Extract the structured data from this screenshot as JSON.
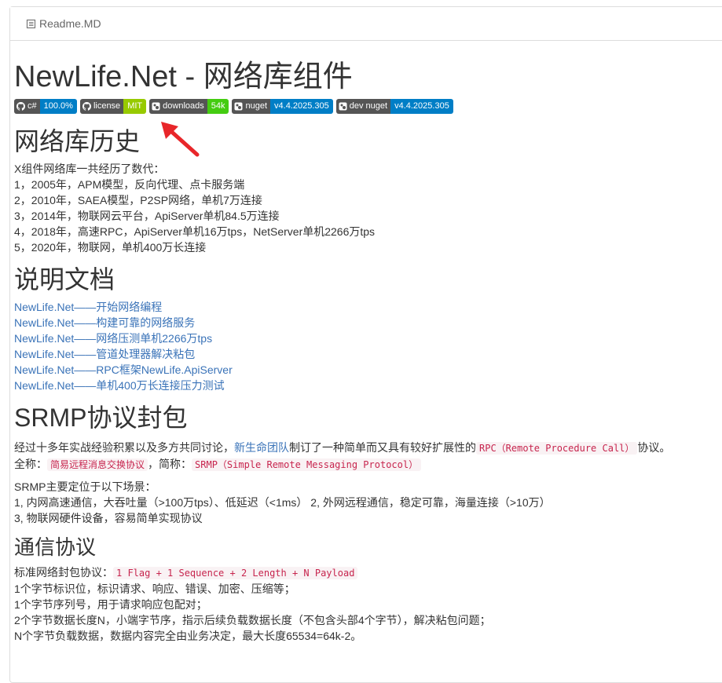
{
  "header": {
    "filename": "Readme.MD"
  },
  "title": "NewLife.Net - 网络库组件",
  "badges": [
    {
      "label": "c#",
      "value": "100.0%",
      "color": "#007ec6"
    },
    {
      "label": "license",
      "value": "MIT",
      "color": "#97ca00"
    },
    {
      "label": "downloads",
      "value": "54k",
      "color": "#4c1"
    },
    {
      "label": "nuget",
      "value": "v4.4.2025.305",
      "color": "#007ec6"
    },
    {
      "label": "dev nuget",
      "value": "v4.4.2025.305",
      "color": "#007ec6"
    }
  ],
  "history": {
    "heading": "网络库历史",
    "intro": "X组件网络库一共经历了数代：",
    "items": [
      "1，2005年，APM模型，反向代理、点卡服务端",
      "2，2010年，SAEA模型，P2SP网络，单机7万连接",
      "3，2014年，物联网云平台，ApiServer单机84.5万连接",
      "4，2018年，高速RPC，ApiServer单机16万tps，NetServer单机2266万tps",
      "5，2020年，物联网，单机400万长连接"
    ]
  },
  "docs": {
    "heading": "说明文档",
    "links": [
      "NewLife.Net——开始网络编程",
      "NewLife.Net——构建可靠的网络服务",
      "NewLife.Net——网络压测单机2266万tps",
      "NewLife.Net——管道处理器解决粘包",
      "NewLife.Net——RPC框架NewLife.ApiServer",
      "NewLife.Net——单机400万长连接压力测试"
    ]
  },
  "srmp": {
    "heading": "SRMP协议封包",
    "p1_pre": "经过十多年实战经验积累以及多方共同讨论，",
    "p1_link": "新生命团队",
    "p1_mid": "制订了一种简单而又具有较好扩展性的",
    "p1_code": "RPC（Remote Procedure Call）",
    "p1_post": "协议。",
    "full_label": "全称：",
    "full_code": "简易远程消息交换协议",
    "short_label": "，简称：",
    "short_code": "SRMP（Simple Remote Messaging Protocol）",
    "scene_title": "SRMP主要定位于以下场景：",
    "scene_1": "1, 内网高速通信，大吞吐量（>100万tps）、低延迟（<1ms） 2, 外网远程通信，稳定可靠，海量连接（>10万）",
    "scene_2": "3, 物联网硬件设备，容易简单实现协议"
  },
  "comm": {
    "heading": "通信协议",
    "std_label": "标准网络封包协议：",
    "std_code": "1 Flag + 1 Sequence + 2 Length + N Payload",
    "items": [
      "1个字节标识位，标识请求、响应、错误、加密、压缩等；",
      "1个字节序列号，用于请求响应包配对；",
      "2个字节数据长度N，小端字节序，指示后续负载数据长度（不包含头部4个字节），解决粘包问题；",
      "N个字节负载数据，数据内容完全由业务决定，最大长度65534=64k-2。"
    ]
  }
}
